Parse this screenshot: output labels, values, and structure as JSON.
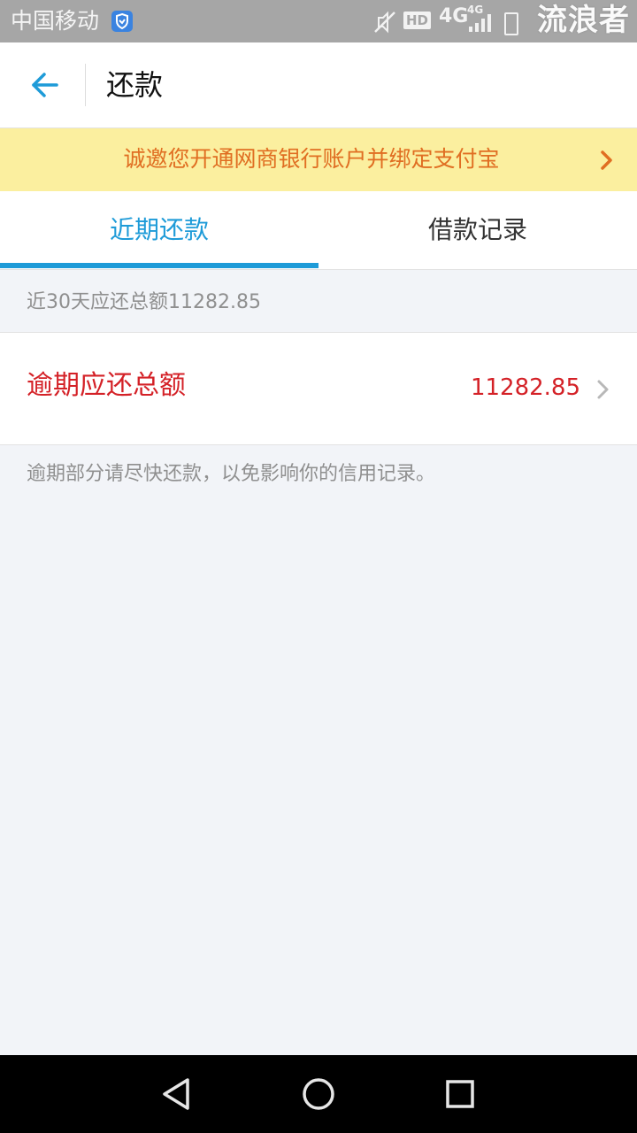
{
  "status_bar": {
    "carrier": "中国移动",
    "hd_label": "HD",
    "network_label": "4G",
    "network_label_small": "4G",
    "watermark": "流浪者",
    "icons": [
      "shield-icon",
      "mute-icon",
      "signal-icon",
      "battery-icon"
    ]
  },
  "header": {
    "back_icon": "arrow-left-icon",
    "title": "还款"
  },
  "banner": {
    "text": "诚邀您开通网商银行账户并绑定支付宝",
    "icon": "chevron-right-icon"
  },
  "tabs": [
    {
      "label": "近期还款",
      "active": true
    },
    {
      "label": "借款记录",
      "active": false
    }
  ],
  "summary": {
    "text": "近30天应还总额11282.85"
  },
  "overdue": {
    "label": "逾期应还总额",
    "amount": "11282.85",
    "icon": "chevron-right-icon"
  },
  "notice": {
    "text": "逾期部分请尽快还款，以免影响你的信用记录。"
  },
  "nav": {
    "icons": [
      "back-triangle-icon",
      "home-circle-icon",
      "recents-square-icon"
    ]
  },
  "colors": {
    "accent": "#1e9bd8",
    "danger": "#d42127",
    "banner_bg": "#fbef9f",
    "banner_text": "#e06e22",
    "page_bg": "#f2f4f8"
  }
}
